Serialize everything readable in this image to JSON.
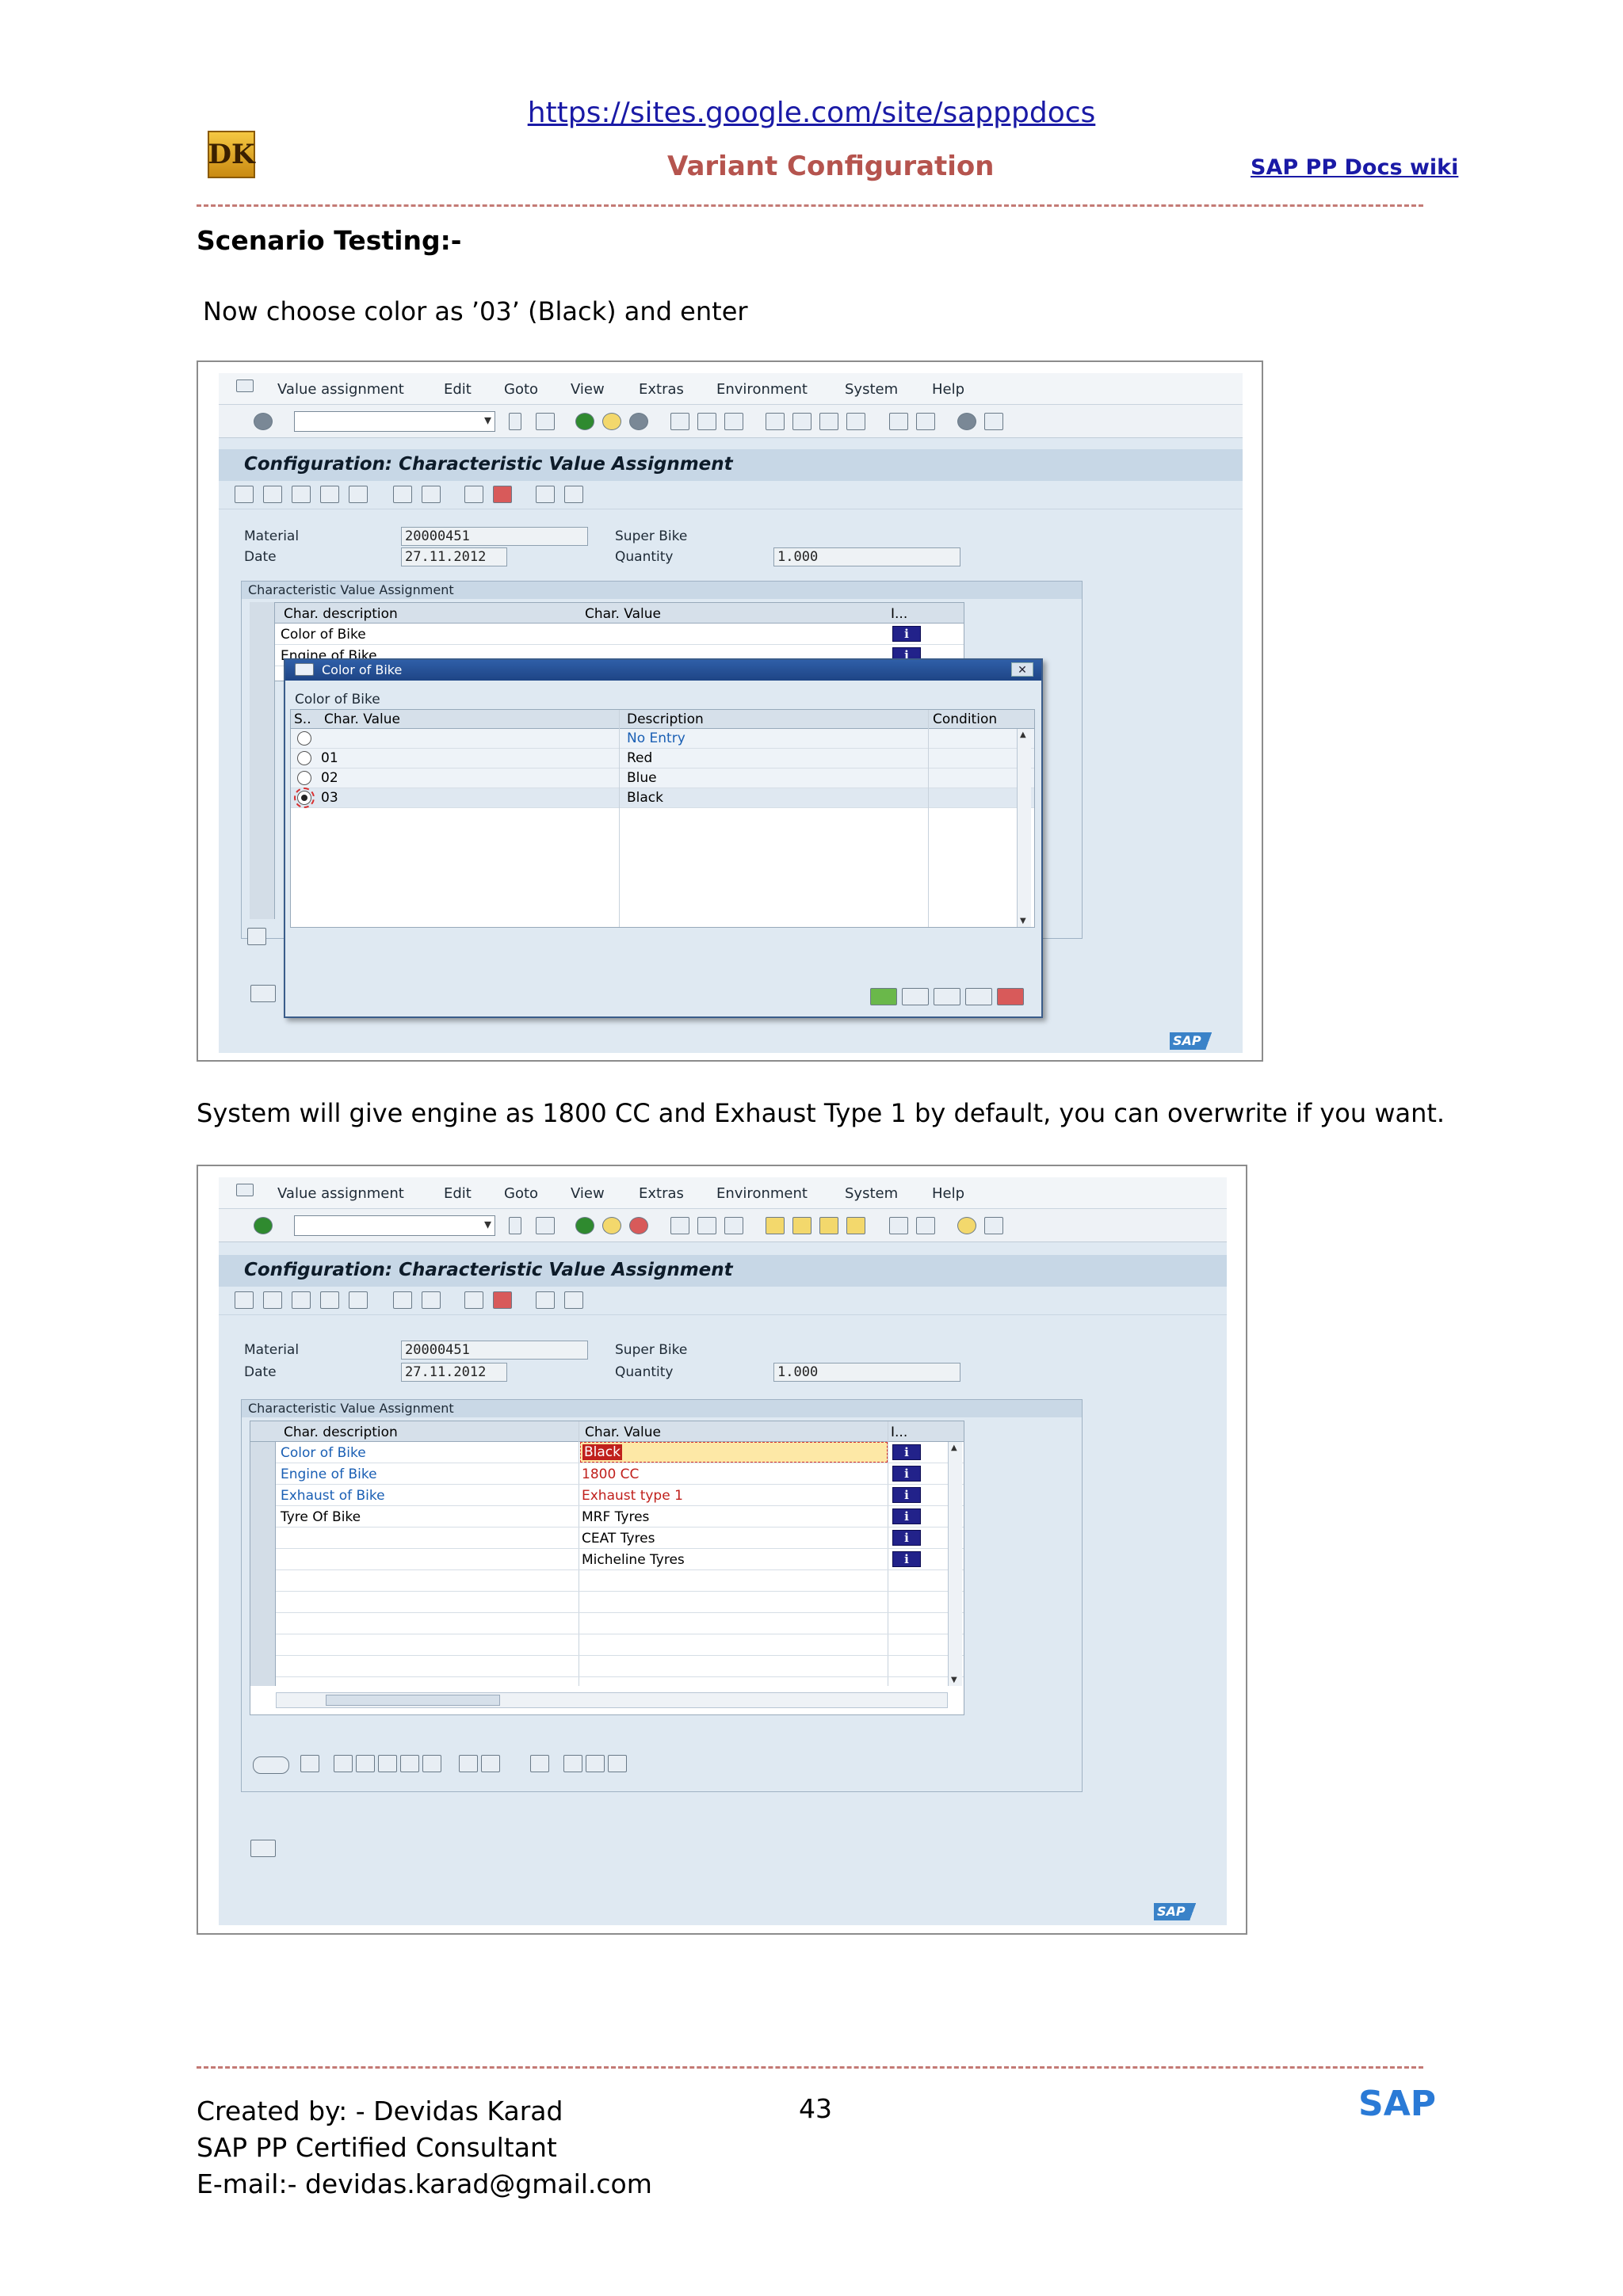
{
  "header": {
    "url": "https://sites.google.com/site/sapppdocs",
    "logo": "DK",
    "title": "Variant Configuration",
    "wiki_link": "SAP PP Docs wiki"
  },
  "heading": "Scenario Testing:-",
  "para1": "Now choose color as ’03’ (Black) and enter",
  "para2": "System will give engine as 1800 CC and Exhaust Type 1 by default, you can overwrite if you want.",
  "sap": {
    "menu": [
      "Value assignment",
      "Edit",
      "Goto",
      "View",
      "Extras",
      "Environment",
      "System",
      "Help"
    ],
    "screen_title": "Configuration: Characteristic Value Assignment",
    "material_label": "Material",
    "material_value": "20000451",
    "material_desc": "Super Bike",
    "date_label": "Date",
    "date_value": "27.11.2012",
    "quantity_label": "Quantity",
    "quantity_value": "1.000",
    "group_title": "Characteristic Value Assignment",
    "col_desc": "Char. description",
    "col_value": "Char. Value",
    "col_info": "I...",
    "brand": "SAP"
  },
  "shot1": {
    "rows": [
      {
        "desc": "Color of Bike",
        "value": ""
      },
      {
        "desc": "Engine of Bike",
        "value": ""
      }
    ],
    "dialog": {
      "title": "Color of Bike",
      "label": "Color of Bike",
      "col_s": "S..",
      "col_value": "Char. Value",
      "col_desc": "Description",
      "col_cond": "Condition",
      "options": [
        {
          "value": "",
          "desc": "No Entry",
          "selected": false
        },
        {
          "value": "01",
          "desc": "Red",
          "selected": false
        },
        {
          "value": "02",
          "desc": "Blue",
          "selected": false
        },
        {
          "value": "03",
          "desc": "Black",
          "selected": true
        }
      ]
    }
  },
  "shot2": {
    "rows": [
      {
        "desc": "Color of Bike",
        "value": "Black"
      },
      {
        "desc": "Engine of Bike",
        "value": "1800 CC"
      },
      {
        "desc": "Exhaust of Bike",
        "value": "Exhaust type 1"
      },
      {
        "desc": "Tyre Of Bike",
        "value": "MRF Tyres"
      },
      {
        "desc": "",
        "value": "CEAT Tyres"
      },
      {
        "desc": "",
        "value": "Micheline Tyres"
      }
    ]
  },
  "footer": {
    "created_by": "Created by: - Devidas Karad",
    "role": "SAP PP Certified Consultant",
    "email": "E-mail:- devidas.karad@gmail.com",
    "page": "43",
    "brand": "SAP"
  }
}
